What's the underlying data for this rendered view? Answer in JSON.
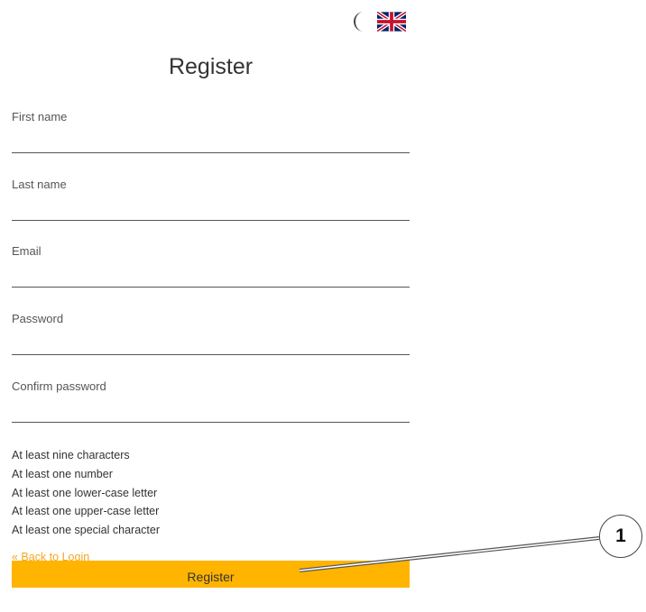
{
  "header": {
    "theme_icon": "moon-icon",
    "language_icon": "uk-flag-icon"
  },
  "title": "Register",
  "fields": [
    {
      "label": "First name",
      "value": ""
    },
    {
      "label": "Last name",
      "value": ""
    },
    {
      "label": "Email",
      "value": ""
    },
    {
      "label": "Password",
      "value": ""
    },
    {
      "label": "Confirm password",
      "value": ""
    }
  ],
  "password_rules": [
    "At least nine characters",
    "At least one number",
    "At least one lower-case letter",
    "At least one upper-case letter",
    "At least one special character"
  ],
  "back_link": "« Back to Login",
  "submit_label": "Register",
  "callout": {
    "number": "1"
  },
  "colors": {
    "accent": "#ffb400",
    "link": "#f5a623",
    "text": "#333333"
  }
}
